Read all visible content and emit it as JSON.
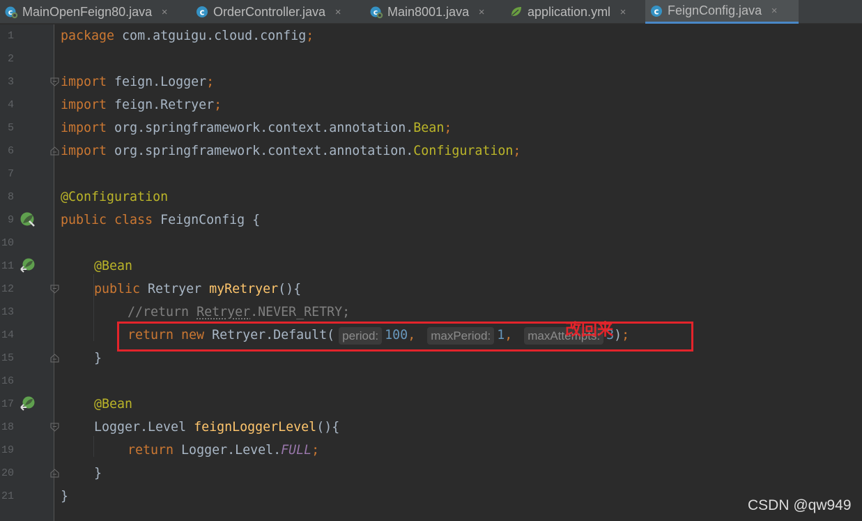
{
  "tabs": [
    {
      "label": "MainOpenFeign80.java",
      "icon": "spring-boot-class-icon",
      "close": "×",
      "active": false
    },
    {
      "label": "OrderController.java",
      "icon": "java-class-icon",
      "close": "×",
      "active": false
    },
    {
      "label": "Main8001.java",
      "icon": "spring-boot-class-icon",
      "close": "×",
      "active": false
    },
    {
      "label": "application.yml",
      "icon": "spring-config-file-icon",
      "close": "×",
      "active": false
    },
    {
      "label": "FeignConfig.java",
      "icon": "java-class-icon",
      "close": "×",
      "active": true
    }
  ],
  "colors": {
    "editor_bg": "#2b2b2b",
    "gutter_bg": "#313335",
    "keyword": "#cc7832",
    "plain": "#a9b7c6",
    "annotation": "#bbb529",
    "method": "#ffc66d",
    "comment": "#808080",
    "number": "#6897bb",
    "static_field": "#9876aa",
    "highlight_red": "#e3242b",
    "active_tab_underline": "#4a88c7"
  },
  "gutter_icons": [
    {
      "line": 9,
      "icon": "spring-bean-class-icon"
    },
    {
      "line": 11,
      "icon": "spring-bean-navigate-icon"
    },
    {
      "line": 17,
      "icon": "spring-bean-navigate-icon"
    }
  ],
  "code": {
    "l1": {
      "num": "1",
      "a": "package",
      "b": " com.atguigu.cloud.config",
      "c": ";"
    },
    "l2": {
      "num": "2"
    },
    "l3": {
      "num": "3",
      "a": "import",
      "b": " feign.Logger",
      "c": ";"
    },
    "l4": {
      "num": "4",
      "a": "import",
      "b": " feign.Retryer",
      "c": ";"
    },
    "l5": {
      "num": "5",
      "a": "import",
      "b": " org.springframework.context.annotation.",
      "d": "Bean",
      "c": ";"
    },
    "l6": {
      "num": "6",
      "a": "import",
      "b": " org.springframework.context.annotation.",
      "d": "Configuration",
      "c": ";"
    },
    "l7": {
      "num": "7"
    },
    "l8": {
      "num": "8",
      "a": "@Configuration"
    },
    "l9": {
      "num": "9",
      "a": "public class",
      "b": " FeignConfig {"
    },
    "l10": {
      "num": "10"
    },
    "l11": {
      "num": "11",
      "a": "@Bean"
    },
    "l12": {
      "num": "12",
      "a": "public",
      "b": " Retryer ",
      "d": "myRetryer",
      "e": "(){"
    },
    "l13": {
      "num": "13",
      "a": "//return ",
      "b": "Retryer",
      "c": ".NEVER_RETRY;"
    },
    "l14": {
      "num": "14",
      "a": "return new",
      "b": " Retryer.Default(",
      "h1": "period:",
      "v1": "100",
      "s1": ", ",
      "h2": "maxPeriod:",
      "v2": "1",
      "s2": ", ",
      "h3": "maxAttempts:",
      "v3": "3",
      "e": ")",
      "c": ";"
    },
    "l15": {
      "num": "15",
      "b": "}"
    },
    "l16": {
      "num": "16"
    },
    "l17": {
      "num": "17",
      "a": "@Bean"
    },
    "l18": {
      "num": "18",
      "b": "Logger.Level ",
      "d": "feignLoggerLevel",
      "e": "(){"
    },
    "l19": {
      "num": "19",
      "a": "return",
      "b": " Logger.Level.",
      "d": "FULL",
      "c": ";"
    },
    "l20": {
      "num": "20",
      "b": "}"
    },
    "l21": {
      "num": "21",
      "b": "}"
    }
  },
  "annotation_text": "改回来",
  "watermark": "CSDN @qw949"
}
